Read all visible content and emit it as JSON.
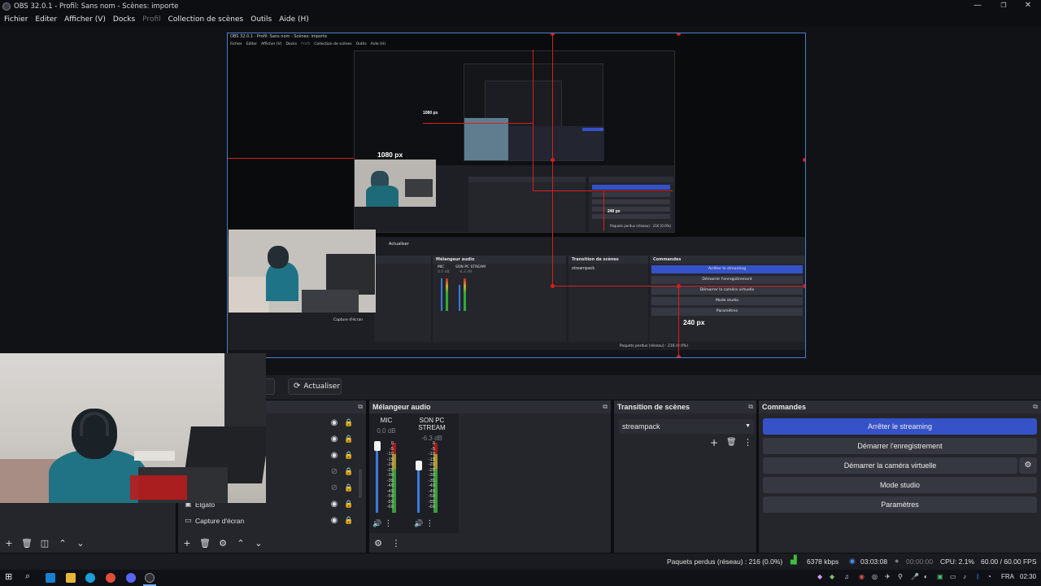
{
  "window": {
    "title": "OBS 32.0.1 - Profil: Sans nom - Scènes: importe",
    "minimize": "—",
    "maximize": "❐",
    "close": "✕"
  },
  "menu": [
    "Fichier",
    "Editer",
    "Afficher (V)",
    "Docks",
    "Profil",
    "Collection de scènes",
    "Outils",
    "Aide (H)"
  ],
  "preview": {
    "labels": {
      "h1080_a": "1080 px",
      "h1080_b": "1080 px",
      "w240_a": "240 px",
      "w240_b": "240 px"
    },
    "inner": {
      "title": "OBS 32.0.1 - Profil: Sans nom - Scènes: importe",
      "menu": [
        "Fichier",
        "Editer",
        "Afficher (V)",
        "Docks",
        "Profil",
        "Collection de scènes",
        "Outils",
        "Aide (H)"
      ],
      "refresh": "Actualiser",
      "mixer_title": "Mélangeur audio",
      "mixer_channels": [
        {
          "name": "MIC",
          "db": "0.0 dB"
        },
        {
          "name": "SON PC STREAM",
          "db": "-6.3 dB"
        }
      ],
      "transition_title": "Transition de scènes",
      "transition_value": "streampack",
      "commands_title": "Commandes",
      "commands": [
        "Arrêter le streaming",
        "Démarrer l'enregistrement",
        "Démarrer la caméra virtuelle",
        "Mode studio",
        "Paramètres"
      ],
      "sources": [
        "Elgato",
        "Capture d'écran"
      ],
      "status": "Paquets perdus (réseau) : 216 (0.0%)"
    }
  },
  "toolbar": {
    "refresh_label": "Actualiser",
    "ghost_label": "r"
  },
  "sources": {
    "items": [
      {
        "label": "",
        "visible": true
      },
      {
        "label": "",
        "visible": true
      },
      {
        "label": "",
        "visible": true
      },
      {
        "label": "",
        "visible": false
      },
      {
        "label": "",
        "visible": false
      },
      {
        "label": "Elgato",
        "visible": true
      },
      {
        "label": "Capture d'écran",
        "visible": true
      }
    ]
  },
  "mixer": {
    "title": "Mélangeur audio",
    "channels": [
      {
        "name": "MIC",
        "db": "0.0 dB",
        "level": 1.0
      },
      {
        "name": "SON PC STREAM",
        "db": "-6.3 dB",
        "level": 0.72
      }
    ],
    "scale": [
      "0",
      "-5",
      "-10",
      "-15",
      "-20",
      "-25",
      "-30",
      "-35",
      "-40",
      "-45",
      "-50",
      "-55",
      "-60"
    ]
  },
  "transitions": {
    "title": "Transition de scènes",
    "selected": "streampack"
  },
  "commands": {
    "title": "Commandes",
    "stop_streaming": "Arrêter le streaming",
    "start_recording": "Démarrer l'enregistrement",
    "start_virtualcam": "Démarrer la caméra virtuelle",
    "studio_mode": "Mode studio",
    "settings": "Paramètres"
  },
  "status": {
    "dropped": "Paquets perdus (réseau) : 216 (0.0%)",
    "bitrate": "6378 kbps",
    "stream_time": "03:03:08",
    "rec_time": "00:00:00",
    "cpu": "CPU: 2.1%",
    "fps": "60.00 / 60.00 FPS"
  },
  "taskbar": {
    "lang": "FRA",
    "time": "02:30"
  },
  "colors": {
    "accent": "#3652c9",
    "guide_red": "#d81e1e",
    "panel": "#24262c",
    "header": "#2c2e35"
  }
}
